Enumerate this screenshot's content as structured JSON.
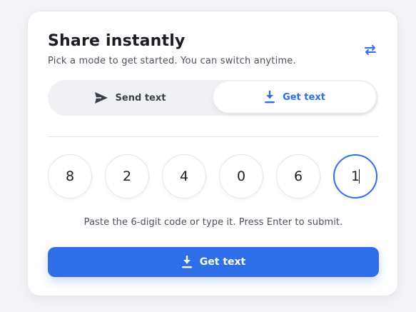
{
  "header": {
    "title": "Share instantly",
    "subtitle": "Pick a mode to get started. You can switch anytime.",
    "swap_icon": "swap-arrows-icon"
  },
  "mode_switch": {
    "options": [
      {
        "label": "Send text",
        "icon": "send-icon",
        "selected": false
      },
      {
        "label": "Get text",
        "icon": "download-icon",
        "selected": true
      }
    ]
  },
  "code": {
    "digits": [
      "8",
      "2",
      "4",
      "0",
      "6",
      "1"
    ],
    "active_index": 5,
    "hint": "Paste the 6-digit code or type it. Press Enter to submit."
  },
  "submit": {
    "label": "Get text",
    "icon": "download-icon"
  },
  "colors": {
    "accent": "#2f6ee9",
    "background": "#f3f4f7",
    "card": "#ffffff"
  }
}
